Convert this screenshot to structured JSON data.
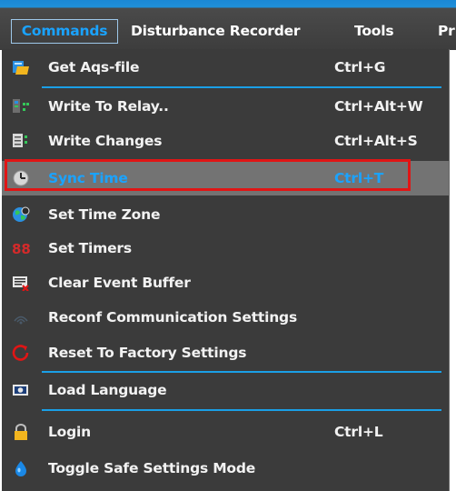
{
  "menubar": {
    "items": [
      "Commands",
      "Disturbance Recorder",
      "Tools",
      "Pr"
    ]
  },
  "dropdown": {
    "items": [
      {
        "label": "Get Aqs-file",
        "shortcut": "Ctrl+G",
        "icon": "folder-file-icon"
      },
      {
        "label": "Write To Relay..",
        "shortcut": "Ctrl+Alt+W",
        "icon": "write-relay-icon"
      },
      {
        "label": "Write Changes",
        "shortcut": "Ctrl+Alt+S",
        "icon": "write-changes-icon"
      },
      {
        "label": "Sync Time",
        "shortcut": "Ctrl+T",
        "icon": "clock-icon",
        "selected": true
      },
      {
        "label": "Set Time Zone",
        "shortcut": "",
        "icon": "globe-icon"
      },
      {
        "label": "Set Timers",
        "shortcut": "",
        "icon": "timer-digits-icon"
      },
      {
        "label": "Clear Event Buffer",
        "shortcut": "",
        "icon": "clear-buffer-icon"
      },
      {
        "label": "Reconf Communication Settings",
        "shortcut": "",
        "icon": "wireless-icon"
      },
      {
        "label": "Reset To Factory Settings",
        "shortcut": "",
        "icon": "reset-icon"
      },
      {
        "label": "Load Language",
        "shortcut": "",
        "icon": "language-icon"
      },
      {
        "label": "Login",
        "shortcut": "Ctrl+L",
        "icon": "lock-icon"
      },
      {
        "label": "Toggle Safe Settings Mode",
        "shortcut": "",
        "icon": "safe-mode-icon"
      }
    ]
  },
  "colors": {
    "menubar_bg": "#3d3d3d",
    "dropdown_bg": "#3b3b3b",
    "accent": "#1aa3ff",
    "separator": "#1a9fe6",
    "highlight_outline": "#e01515",
    "selected_bg": "#737373"
  }
}
